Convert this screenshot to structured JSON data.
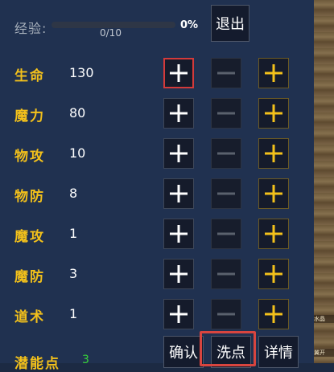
{
  "experience": {
    "label": "经验:",
    "count": "0/10",
    "percent": "0%",
    "progress_fraction": 0
  },
  "exit_label": "退出",
  "stats": [
    {
      "name": "生命",
      "value": "130"
    },
    {
      "name": "魔力",
      "value": "80"
    },
    {
      "name": "物攻",
      "value": "10"
    },
    {
      "name": "物防",
      "value": "8"
    },
    {
      "name": "魔攻",
      "value": "1"
    },
    {
      "name": "魔防",
      "value": "3"
    },
    {
      "name": "道术",
      "value": "1"
    }
  ],
  "potential": {
    "label": "潜能点",
    "value": "3"
  },
  "buttons": {
    "confirm": "确认",
    "reset": "洗点",
    "details": "详情"
  },
  "scene": {
    "marks": [
      "水晶",
      "翼开"
    ]
  },
  "colors": {
    "accent": "#f3c11b",
    "positive": "#38d43a",
    "highlight": "#d8453f"
  },
  "icons": {
    "add": "plus-icon",
    "subtract": "minus-icon",
    "add_gold": "plus-icon-gold"
  }
}
